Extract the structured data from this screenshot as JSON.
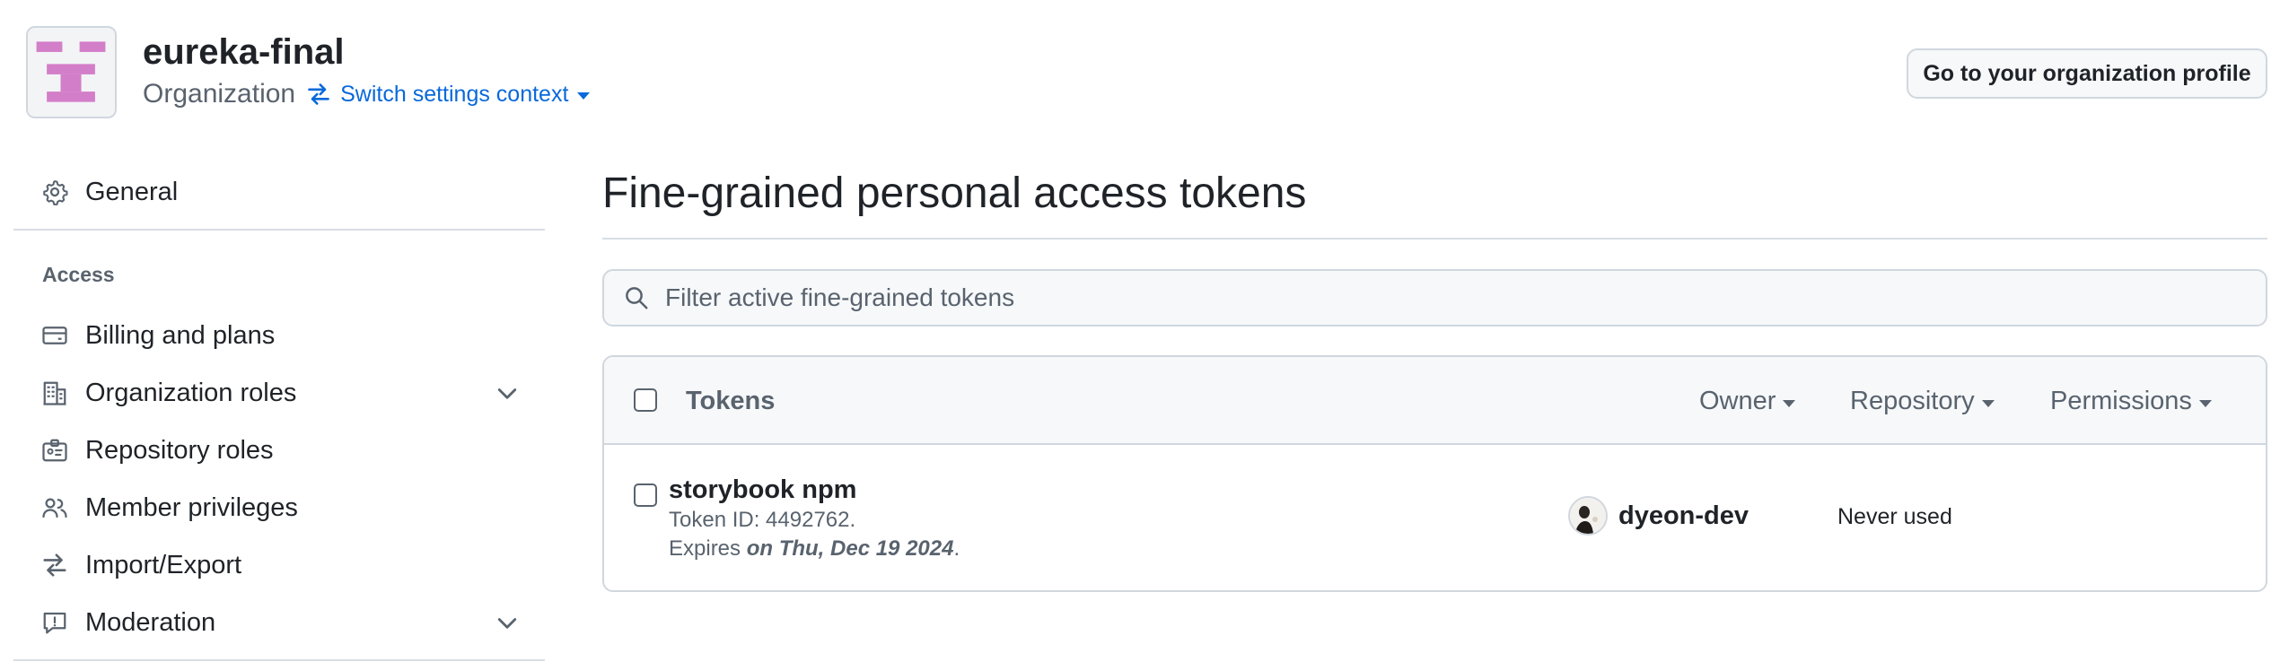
{
  "header": {
    "org_name": "eureka-final",
    "org_kind": "Organization",
    "switch_context_label": "Switch settings context",
    "profile_button_label": "Go to your organization profile"
  },
  "sidebar": {
    "general_label": "General",
    "access_heading": "Access",
    "items": [
      {
        "label": "Billing and plans",
        "icon": "credit-card-icon",
        "expandable": false
      },
      {
        "label": "Organization roles",
        "icon": "organization-icon",
        "expandable": true
      },
      {
        "label": "Repository roles",
        "icon": "id-badge-icon",
        "expandable": false
      },
      {
        "label": "Member privileges",
        "icon": "people-icon",
        "expandable": false
      },
      {
        "label": "Import/Export",
        "icon": "arrow-switch-icon",
        "expandable": false
      },
      {
        "label": "Moderation",
        "icon": "report-icon",
        "expandable": true
      }
    ]
  },
  "main": {
    "title": "Fine-grained personal access tokens",
    "filter_placeholder": "Filter active fine-grained tokens",
    "table": {
      "header_label": "Tokens",
      "filters": [
        "Owner",
        "Repository",
        "Permissions"
      ],
      "rows": [
        {
          "name": "storybook npm",
          "token_id": "Token ID: 4492762.",
          "expires_prefix": "Expires ",
          "expires_date": "on Thu, Dec 19 2024",
          "expires_suffix": ".",
          "owner": "dyeon-dev",
          "last_used": "Never used"
        }
      ]
    }
  },
  "colors": {
    "link": "#0969da",
    "text": "#1f2328",
    "muted": "#59636e",
    "border": "#d0d7de",
    "canvas_subtle": "#f6f8fa",
    "org_avatar_accent": "#d37ec9"
  }
}
